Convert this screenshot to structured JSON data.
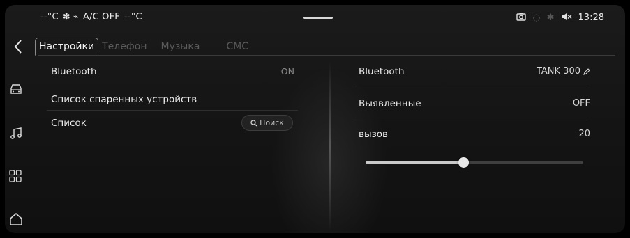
{
  "status_bar": {
    "temp_left": "--°C",
    "ac_label": "A/C OFF",
    "temp_right": "--°C",
    "time": "13:28",
    "icons": [
      "fan-icon",
      "seat-heat-icon",
      "camera-icon",
      "signal-icon",
      "bluetooth-icon",
      "mute-icon"
    ]
  },
  "tabs": [
    {
      "label": "Настройки",
      "active": true
    },
    {
      "label": "Телефон",
      "active": false
    },
    {
      "label": "Музыка",
      "active": false
    },
    {
      "label": "СМС",
      "active": false
    }
  ],
  "sidebar": {
    "icons": [
      "car-icon",
      "music-icon",
      "apps-grid-icon",
      "home-icon"
    ]
  },
  "left_panel": {
    "bluetooth_label": "Bluetooth",
    "bluetooth_value": "ON",
    "paired_devices_label": "Список спаренных устройств",
    "list_label": "Список",
    "search_label": "Поиск"
  },
  "right_panel": {
    "bluetooth_label": "Bluetooth",
    "device_name": "TANK 300",
    "discoverable_label": "Выявленные",
    "discoverable_value": "OFF",
    "call_label": "вызов",
    "call_value": "20",
    "call_volume_fraction": 0.45
  },
  "colors": {
    "background": "#141414",
    "text": "#ececec",
    "dim_text": "#5a5a5a",
    "accent": "#c9c9c9"
  }
}
